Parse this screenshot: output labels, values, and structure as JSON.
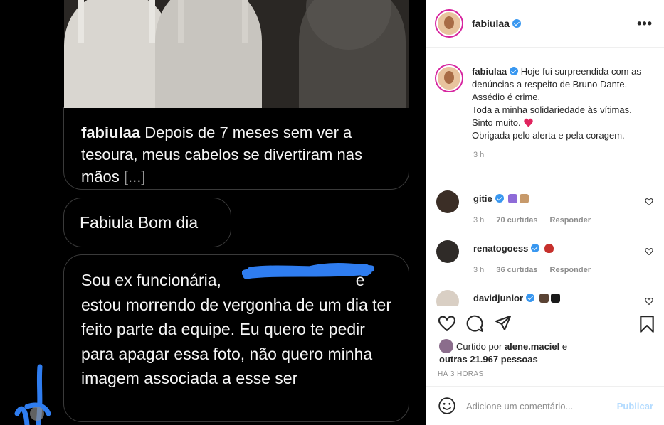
{
  "media": {
    "dm_messages": [
      {
        "user": "fabiulaa",
        "text": "Depois de 7 meses sem ver a tesoura, meus cabelos se divertiram nas mãos",
        "ellipsis": "[...]"
      },
      {
        "text": "Fabiula Bom dia"
      },
      {
        "text_before": "Sou ex funcionária,",
        "text_after": "e estou morrendo de vergonha de um dia ter feito parte da equipe. Eu quero te pedir para apagar essa foto, não quero minha imagem associada a esse ser"
      }
    ],
    "scribble_color": "#2f7df0"
  },
  "post_header": {
    "username": "fabiulaa",
    "more_icon": "more-horizontal-icon"
  },
  "caption": {
    "username": "fabiulaa",
    "lines": [
      "Hoje fui surpreendida com as denúncias a respeito de Bruno Dante.",
      "Assédio é crime.",
      "Toda a minha solidariedade às vítimas.",
      "Sinto muito.",
      "Obrigada pelo alerta e pela coragem."
    ],
    "time": "3 h"
  },
  "comments": [
    {
      "username": "gitie",
      "time": "3 h",
      "likes": "70 curtidas",
      "reply": "Responder"
    },
    {
      "username": "renatogoess",
      "time": "3 h",
      "likes": "36 curtidas",
      "reply": "Responder"
    },
    {
      "username": "davidjunior"
    }
  ],
  "likes": {
    "prefix": "Curtido por",
    "user": "alene.maciel",
    "conj": "e",
    "others": "outras 21.967 pessoas"
  },
  "posted_ago": "HÁ 3 HORAS",
  "add_comment": {
    "placeholder": "Adicione um comentário...",
    "publish_label": "Publicar"
  },
  "colors": {
    "verified": "#3897f0",
    "story_ring": "#d6249f",
    "publish_disabled": "#b3dbff"
  }
}
